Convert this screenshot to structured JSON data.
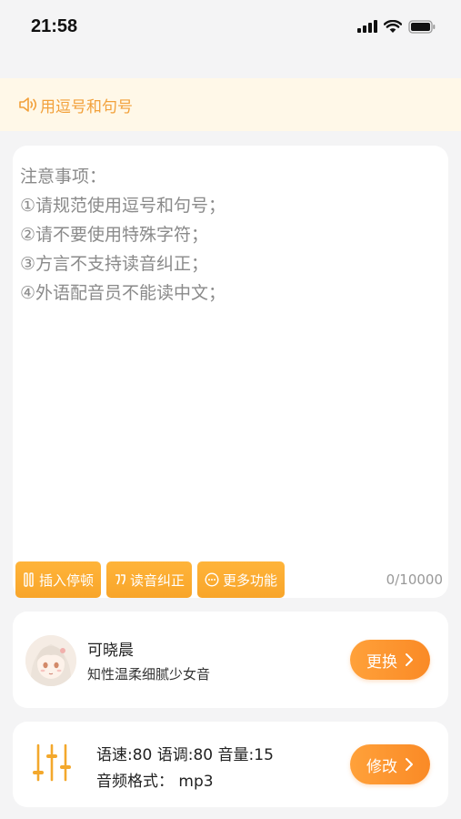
{
  "status_bar": {
    "time": "21:58"
  },
  "notice": {
    "text": "用逗号和句号"
  },
  "editor": {
    "text": "注意事项：\n①请规范使用逗号和句号；\n②请不要使用特殊字符；\n③方言不支持读音纠正；\n④外语配音员不能读中文；",
    "char_count": "0/10000",
    "actions": [
      {
        "label": "插入停顿",
        "icon": "pause-icon"
      },
      {
        "label": "读音纠正",
        "icon": "quote-icon"
      },
      {
        "label": "更多功能",
        "icon": "more-icon"
      }
    ]
  },
  "voice": {
    "name": "可晓晨",
    "description": "知性温柔细腻少女音",
    "change_label": "更换"
  },
  "settings": {
    "line1": "语速:80 语调:80 音量:15",
    "line2": "音频格式： mp3",
    "modify_label": "修改"
  },
  "colors": {
    "accent": "#f8a52a",
    "accent_dark": "#fa8a26",
    "notice_bg": "#fff8e8",
    "notice_text": "#f2a13b"
  }
}
